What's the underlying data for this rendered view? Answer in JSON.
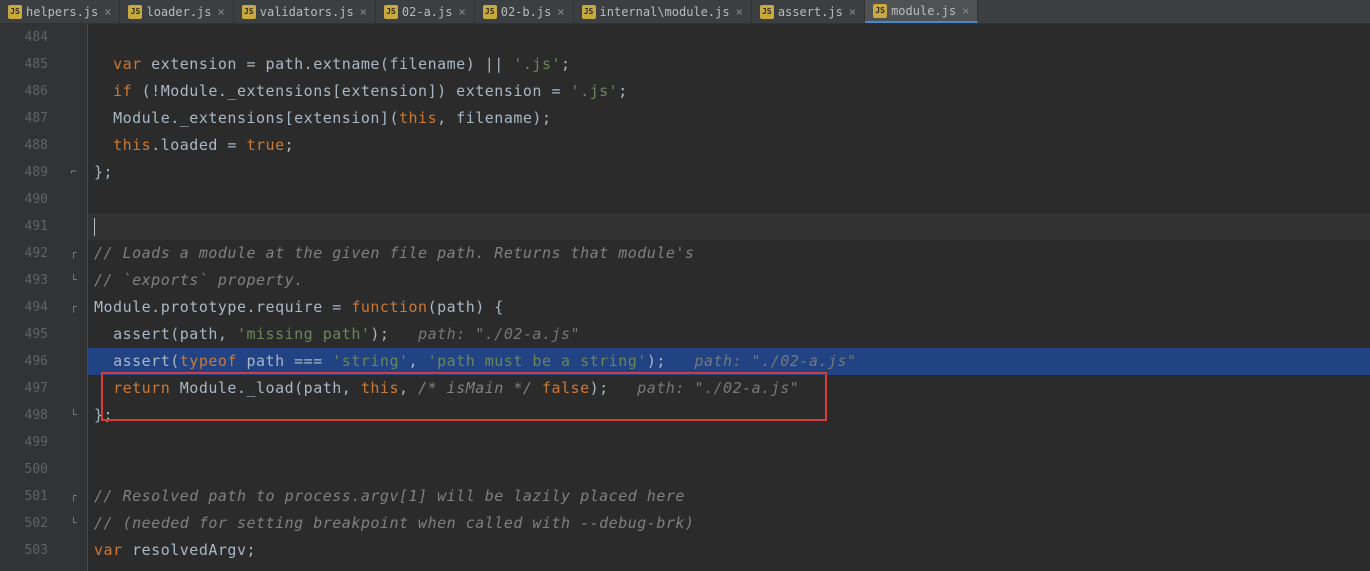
{
  "tabs": [
    {
      "label": "helpers.js",
      "active": false
    },
    {
      "label": "loader.js",
      "active": false
    },
    {
      "label": "validators.js",
      "active": false
    },
    {
      "label": "02-a.js",
      "active": false
    },
    {
      "label": "02-b.js",
      "active": false
    },
    {
      "label": "internal\\module.js",
      "active": false
    },
    {
      "label": "assert.js",
      "active": false
    },
    {
      "label": "module.js",
      "active": true
    }
  ],
  "gutter_start": 484,
  "lines": {
    "l484": {
      "indent": "    ",
      "tokens": []
    },
    "l485": {
      "kw1": "var",
      "t1": " extension = path.extname(filename) || ",
      "str1": "'.js'",
      "t2": ";"
    },
    "l486": {
      "kw1": "if",
      "t1": " (!Module._extensions[extension]) extension = ",
      "str1": "'.js'",
      "t2": ";"
    },
    "l487": {
      "t1": "Module._extensions[extension](",
      "kw1": "this",
      "t2": ", filename);"
    },
    "l488": {
      "kw1": "this",
      "t1": ".loaded = ",
      "kw2": "true",
      "t2": ";"
    },
    "l489": {
      "t1": "};"
    },
    "l490": {
      "t1": ""
    },
    "l491": {
      "t1": ""
    },
    "l492": {
      "c1": "// Loads a module at the given file path. Returns that module's"
    },
    "l493": {
      "c1": "// `exports` property."
    },
    "l494": {
      "t1": "Module.prototype.require = ",
      "kw1": "function",
      "t2": "(path) {"
    },
    "l495": {
      "t1": "assert(path, ",
      "str1": "'missing path'",
      "t2": ");",
      "hint": "path: \"./02-a.js\""
    },
    "l496": {
      "t1": "assert(",
      "kw1": "typeof",
      "t2": " path === ",
      "str1": "'string'",
      "t3": ", ",
      "str2": "'path must be a string'",
      "t4": ");",
      "hint": "path: \"./02-a.js\""
    },
    "l497": {
      "kw1": "return",
      "t1": " Module._load(path, ",
      "kw2": "this",
      "t2": ", ",
      "c1": "/* isMain */",
      "t3": " ",
      "kw3": "false",
      "t4": ");",
      "hint": "path: \"./02-a.js\""
    },
    "l498": {
      "t1": "};"
    },
    "l499": {
      "t1": ""
    },
    "l500": {
      "t1": ""
    },
    "l501": {
      "c1": "// Resolved path to process.argv[1] will be lazily placed here"
    },
    "l502": {
      "c1": "// (needed for setting breakpoint when called with --debug-brk)"
    },
    "l503": {
      "kw1": "var",
      "t1": " resolvedArgv;"
    }
  }
}
